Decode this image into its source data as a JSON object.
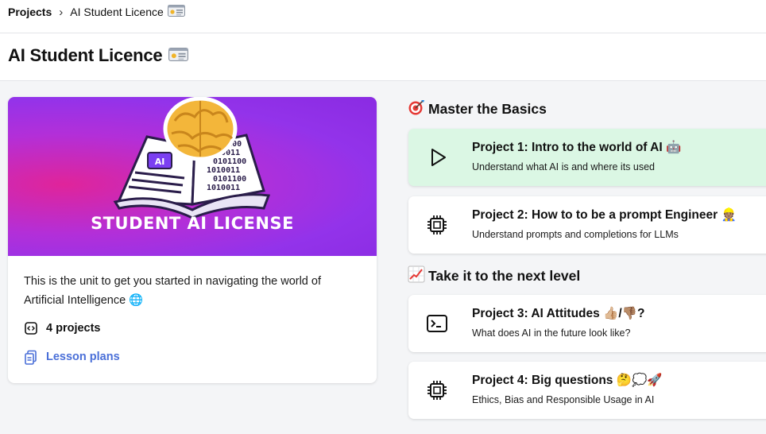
{
  "breadcrumb": {
    "root": "Projects",
    "separator": "›",
    "current": "AI Student Licence",
    "current_icon": "id-card-icon"
  },
  "page": {
    "title": "AI Student Licence",
    "title_icon": "id-card-icon"
  },
  "unit": {
    "hero_text": "STUDENT AI LICENSE",
    "hero_ai_badge": "AI",
    "hero_binary": [
      "101100",
      "0010011",
      "0101100",
      "1010011",
      "0101100",
      "1010011"
    ],
    "description": "This is the unit to get you started in navigating the world of Artificial Intelligence 🌐",
    "projects_count": "4 projects",
    "lesson_plans": "Lesson plans"
  },
  "sections": [
    {
      "emoji": "🎯",
      "title": "Master the Basics",
      "projects": [
        {
          "icon": "play-icon",
          "title": "Project 1: Intro to the world of AI 🤖",
          "subtitle": "Understand what AI is and where its used",
          "active": true
        },
        {
          "icon": "chip-icon",
          "title": "Project 2: How to to be a prompt Engineer 👷🏽",
          "subtitle": "Understand prompts and completions for LLMs",
          "active": false
        }
      ]
    },
    {
      "emoji": "📈",
      "title": "Take it to the next level",
      "projects": [
        {
          "icon": "terminal-icon",
          "title": "Project 3: AI Attitudes 👍🏼/👎🏽?",
          "subtitle": "What does AI in the future look like?",
          "active": false
        },
        {
          "icon": "chip-icon",
          "title": "Project 4: Big questions 🤔💭🚀",
          "subtitle": "Ethics, Bias and Responsible Usage in AI",
          "active": false
        }
      ]
    }
  ],
  "colors": {
    "active_card": "#dbf7e4",
    "link_blue": "#4a6fd8",
    "hero_magenta": "#e0249a",
    "hero_purple": "#8a2be2"
  }
}
